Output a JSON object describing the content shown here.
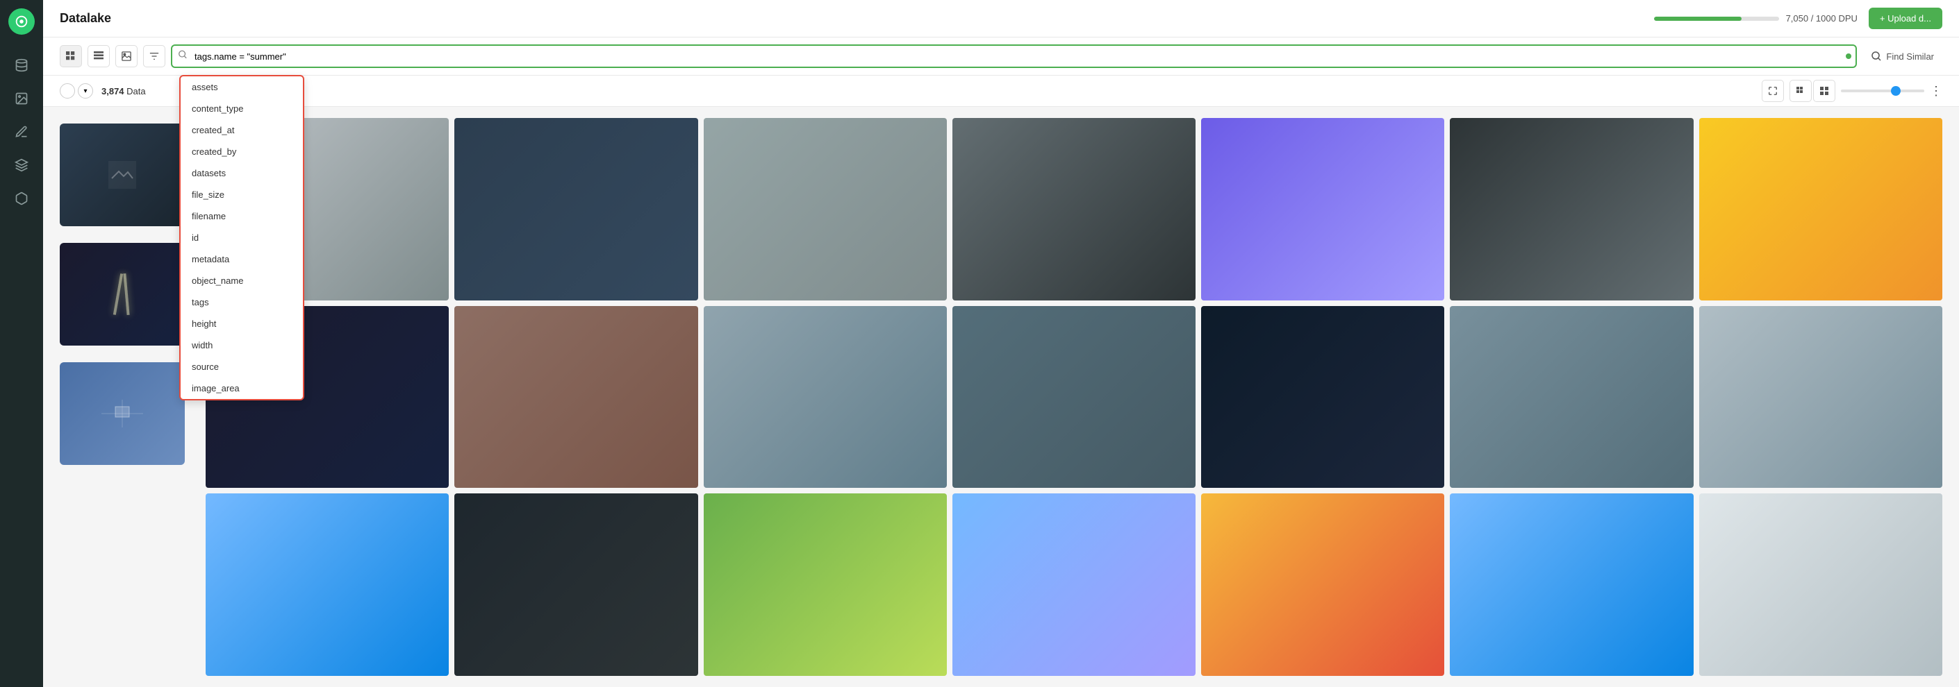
{
  "app": {
    "title": "Datalake"
  },
  "header": {
    "title": "Datalake",
    "dpu_usage": "7,050 / 1000 DPU",
    "upload_btn": "+ Upload d..."
  },
  "toolbar": {
    "search_value": "tags.name = \"summer\"",
    "find_similar": "Find Similar"
  },
  "data_count": {
    "count": "3,874",
    "label": "Data"
  },
  "dropdown": {
    "items": [
      "assets",
      "content_type",
      "created_at",
      "created_by",
      "datasets",
      "file_size",
      "filename",
      "id",
      "metadata",
      "object_name",
      "tags",
      "height",
      "width",
      "source",
      "image_area"
    ]
  },
  "sidebar": {
    "items": [
      {
        "name": "home",
        "icon": "⊙"
      },
      {
        "name": "database",
        "icon": "🗄"
      },
      {
        "name": "image",
        "icon": "🖼"
      },
      {
        "name": "annotation",
        "icon": "✏"
      },
      {
        "name": "layers",
        "icon": "⊕"
      },
      {
        "name": "model",
        "icon": "◈"
      }
    ]
  },
  "images": {
    "row1": [
      "img-dark",
      "img-day",
      "img-day",
      "img-aerial",
      "img-night",
      "img-purple",
      "img-yellow"
    ],
    "row2": [
      "img-night",
      "img-dark",
      "img-day",
      "img-road",
      "img-night",
      "img-day",
      "img-aerial"
    ],
    "row3": [
      "img-aerial",
      "img-night",
      "img-green",
      "img-aerial",
      "img-yellow",
      "img-aerial",
      "img-aerial"
    ],
    "left": [
      "img-dark",
      "img-night",
      "img-aerial"
    ]
  }
}
